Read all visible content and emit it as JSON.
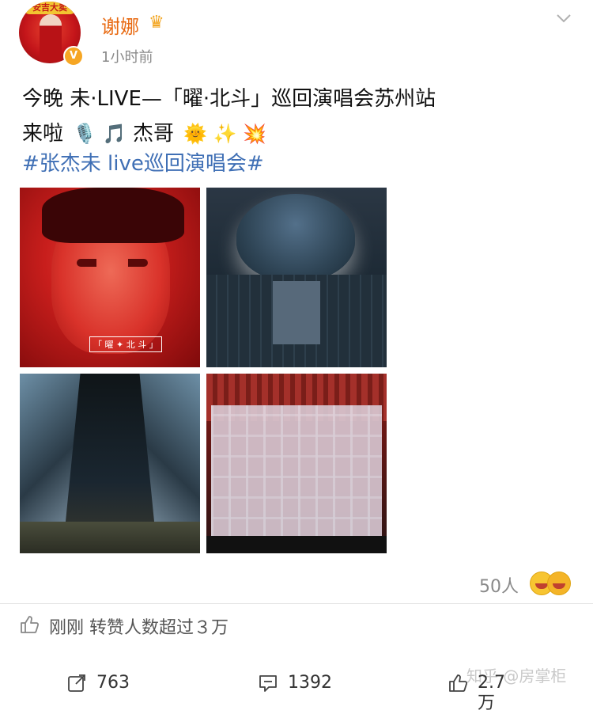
{
  "post": {
    "author": "谢娜",
    "verified_badge": "V",
    "time": "1小时前",
    "text_line1": "今晚 未·LIVE—「曜·北斗」巡回演唱会苏州站",
    "text_line2": "来啦",
    "text_line2_emojis": "🎙️ 🎵",
    "text_line2_name": "杰哥",
    "text_line2_trailing_emojis": "🌞 ✨ 💥",
    "hashtag": "#张杰未 live巡回演唱会#",
    "images": [
      {
        "alt": "曜·北斗 poster",
        "caption": "「 曜 ✦ 北 斗 」"
      },
      {
        "alt": "stage with globe"
      },
      {
        "alt": "stage towers"
      },
      {
        "alt": "stage set"
      }
    ],
    "avatar_banner": "安吉大卖"
  },
  "reactions": {
    "count": "50人"
  },
  "like_note": "刚刚 转赞人数超过３万",
  "actions": {
    "repost_count": "763",
    "comment_count": "1392",
    "like_count": "2.7万"
  },
  "watermark": "知乎 @房掌柜",
  "icons": {
    "crown": "crown-icon",
    "chevron": "chevron-down-icon",
    "thumb": "thumbs-up-icon",
    "repost": "share-icon",
    "comment": "comment-icon"
  },
  "colors": {
    "username": "#e86a12",
    "hashtag": "#3f6fb5",
    "verified": "#f6a623"
  }
}
